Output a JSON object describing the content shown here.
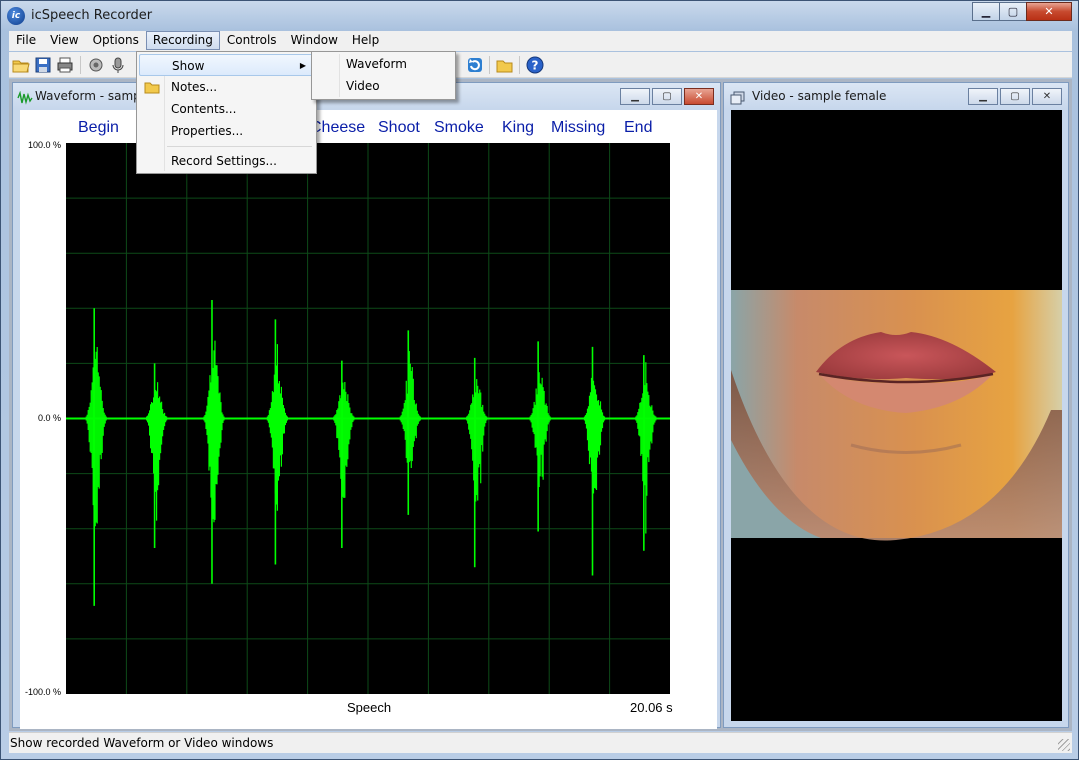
{
  "app": {
    "title": "icSpeech Recorder",
    "icon_text": "ic"
  },
  "window_buttons": {
    "minimize": "▁",
    "maximize": "▢",
    "close": "✕"
  },
  "menubar": {
    "items": [
      {
        "label": "File"
      },
      {
        "label": "View"
      },
      {
        "label": "Options"
      },
      {
        "label": "Recording"
      },
      {
        "label": "Controls"
      },
      {
        "label": "Window"
      },
      {
        "label": "Help"
      }
    ],
    "active": "Recording"
  },
  "recording_menu": {
    "items": [
      {
        "label": "Show"
      },
      {
        "label": "Notes..."
      },
      {
        "label": "Contents..."
      },
      {
        "label": "Properties..."
      },
      {
        "label": "Record Settings..."
      }
    ]
  },
  "show_submenu": {
    "items": [
      {
        "label": "Waveform"
      },
      {
        "label": "Video"
      }
    ]
  },
  "toolbar": {
    "icons": [
      "open-folder-icon",
      "save-icon",
      "print-icon",
      "record-settings-icon",
      "playback-settings-icon",
      "loop-icon",
      "notes-icon",
      "help-icon"
    ]
  },
  "waveform_window": {
    "title": "Waveform - sample female",
    "words": [
      "Begin",
      "Cheese",
      "Shoot",
      "Smoke",
      "King",
      "Missing",
      "End"
    ],
    "y_labels": [
      "100.0 %",
      "0.0 %",
      "-100.0 %"
    ],
    "x_label": "Speech",
    "duration": "20.06 s",
    "wave_color": "#00ff00",
    "grid_color": "#0d4a18",
    "bursts": [
      {
        "x": 0.05,
        "amp_up": 0.4,
        "amp_dn": 0.68
      },
      {
        "x": 0.15,
        "amp_up": 0.2,
        "amp_dn": 0.47
      },
      {
        "x": 0.245,
        "amp_up": 0.43,
        "amp_dn": 0.6
      },
      {
        "x": 0.35,
        "amp_up": 0.36,
        "amp_dn": 0.53
      },
      {
        "x": 0.46,
        "amp_up": 0.21,
        "amp_dn": 0.47
      },
      {
        "x": 0.57,
        "amp_up": 0.32,
        "amp_dn": 0.35
      },
      {
        "x": 0.68,
        "amp_up": 0.22,
        "amp_dn": 0.54
      },
      {
        "x": 0.785,
        "amp_up": 0.28,
        "amp_dn": 0.41
      },
      {
        "x": 0.875,
        "amp_up": 0.26,
        "amp_dn": 0.57
      },
      {
        "x": 0.96,
        "amp_up": 0.23,
        "amp_dn": 0.48
      }
    ]
  },
  "video_window": {
    "title": "Video - sample female"
  },
  "status": {
    "text": "Show recorded Waveform or Video windows"
  }
}
